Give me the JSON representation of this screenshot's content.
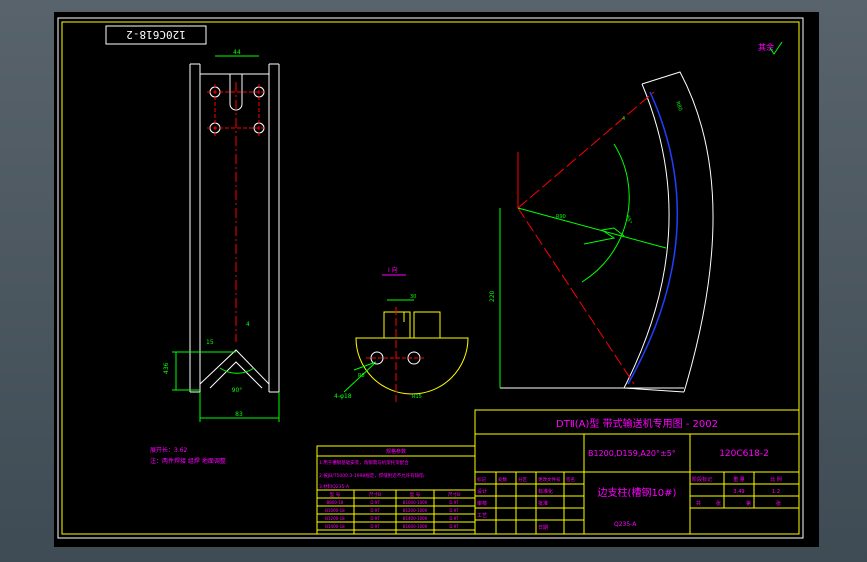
{
  "drawing": {
    "code_top_left": "120C618-2",
    "roughness_mark": "其余",
    "section_title": "Ⅰ 向",
    "dimensions": {
      "top_width": "44",
      "bottom_width": "83",
      "left_length": "436",
      "vertical_max": "220",
      "radius_a": "R90",
      "radius_b": "R80",
      "radius_c": "R15",
      "angle_a": "90°",
      "thick": "4",
      "hole_dim": "4-φ18",
      "rad_small": "R8",
      "sec_dim": "30",
      "arc_label": "65°",
      "arc_label2": "95°",
      "vert_small": "15",
      "corner_ref": "4"
    },
    "notes": {
      "line1": "展开长：3.62",
      "line2": "注：两件焊接 组焊 地面调整"
    },
    "spec_table": {
      "title": "规格参数",
      "line_a": "1.用于槽钢基础安装，角钢需与机架托架配合",
      "line_b": "2.按JB/T5000.3-1998规定，焊缝附近不允许有缺陷",
      "line_c": "3.材料Q235-A",
      "headers": [
        "型 号",
        "尺寸B",
        "型 号",
        "尺寸B"
      ],
      "rows": [
        [
          "B800-18",
          "D.9T",
          "B1000-1000",
          "D.9T"
        ],
        [
          "B1000-18",
          "D.9T",
          "B1200-1000",
          "D.9T"
        ],
        [
          "B1200-18",
          "D.9T",
          "B1400-1000",
          "D.9T"
        ],
        [
          "B1400-18",
          "D.9T",
          "B1600-1000",
          "D.9T"
        ]
      ]
    },
    "title_block": {
      "series_title": "DTⅡ(A)型  带式输送机专用图 - 2002",
      "params": "B1200,D159,A20°±5°",
      "drawing_no": "120C618-2",
      "part_name": "边支柱(槽钢10#)",
      "material": "Q235-A",
      "col_stage": "阶段标记",
      "col_weight": "重 量",
      "col_scale": "比 例",
      "weight_val": "3.49",
      "scale_val": "1:2",
      "sheet_total": "共",
      "sheet_label": "张",
      "sheet_no": "第",
      "sheet_no_label": "张",
      "row_labels": [
        "标记",
        "处数",
        "分区",
        "更改文件号",
        "签名",
        "年月日"
      ],
      "role_design": "设计",
      "role_check": "审核",
      "role_process": "工艺",
      "role_std": "标准化",
      "role_approve": "批准",
      "role_date": "日期"
    }
  }
}
